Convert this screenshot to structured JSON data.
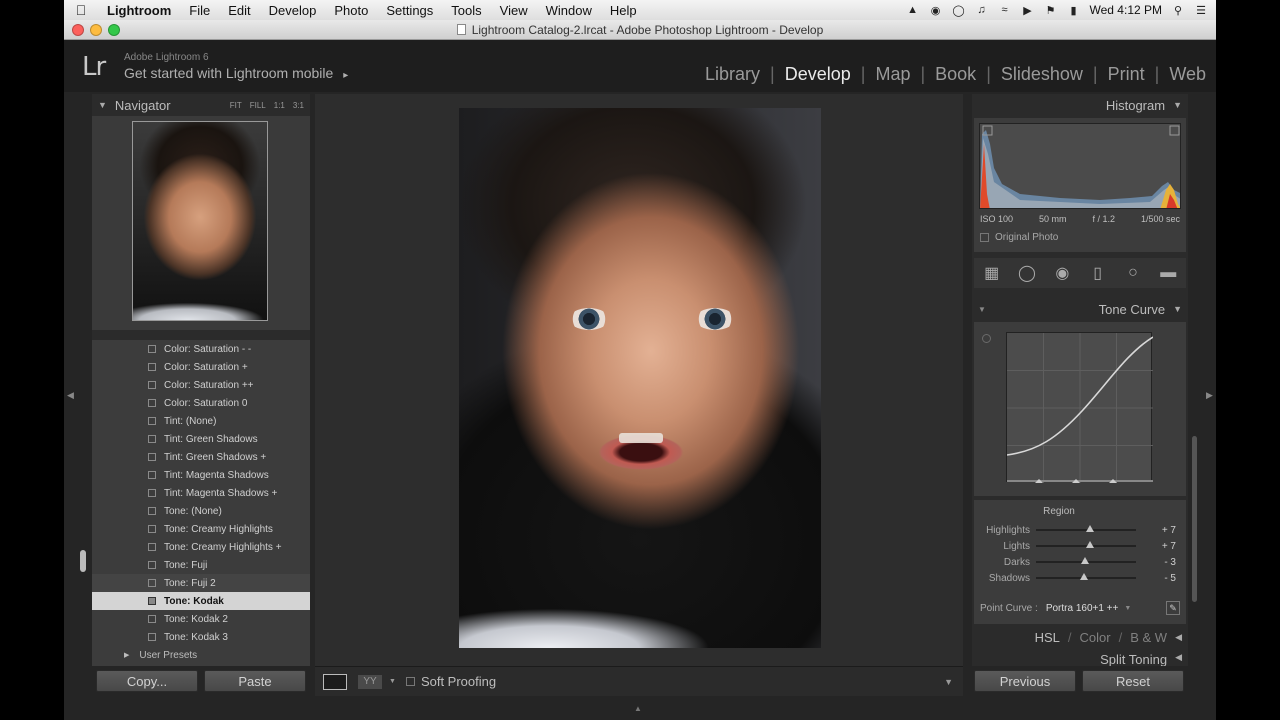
{
  "menubar": {
    "app": "Lightroom",
    "items": [
      "File",
      "Edit",
      "Develop",
      "Photo",
      "Settings",
      "Tools",
      "View",
      "Window",
      "Help"
    ],
    "clock": "Wed 4:12 PM"
  },
  "window": {
    "title": "Lightroom Catalog-2.lrcat - Adobe Photoshop Lightroom - Develop"
  },
  "identity": {
    "logo": "Lr",
    "version": "Adobe Lightroom 6",
    "mobile": "Get started with Lightroom mobile",
    "mobile_arrow": "▸"
  },
  "modules": [
    "Library",
    "Develop",
    "Map",
    "Book",
    "Slideshow",
    "Print",
    "Web"
  ],
  "active_module": "Develop",
  "navigator": {
    "title": "Navigator",
    "zoom_options": [
      "FIT",
      "FILL",
      "1:1",
      "3:1"
    ]
  },
  "presets": [
    {
      "label": "Color: Saturation - -"
    },
    {
      "label": "Color: Saturation +"
    },
    {
      "label": "Color: Saturation ++"
    },
    {
      "label": "Color: Saturation 0"
    },
    {
      "label": "Tint: (None)"
    },
    {
      "label": "Tint: Green Shadows"
    },
    {
      "label": "Tint: Green Shadows +"
    },
    {
      "label": "Tint: Magenta Shadows"
    },
    {
      "label": "Tint: Magenta Shadows +"
    },
    {
      "label": "Tone: (None)"
    },
    {
      "label": "Tone: Creamy Highlights"
    },
    {
      "label": "Tone: Creamy Highlights +"
    },
    {
      "label": "Tone: Fuji"
    },
    {
      "label": "Tone: Fuji 2",
      "state": "hover"
    },
    {
      "label": "Tone: Kodak",
      "state": "selected"
    },
    {
      "label": "Tone: Kodak 2"
    },
    {
      "label": "Tone: Kodak 3"
    }
  ],
  "user_presets": "User Presets",
  "left_buttons": {
    "copy": "Copy...",
    "paste": "Paste"
  },
  "toolbar": {
    "yy": "YY",
    "soft_proofing": "Soft Proofing"
  },
  "histogram": {
    "title": "Histogram",
    "iso": "ISO 100",
    "focal": "50 mm",
    "aperture": "f / 1.2",
    "shutter": "1/500 sec",
    "original_photo": "Original Photo"
  },
  "tone_curve": {
    "title": "Tone Curve",
    "region_title": "Region",
    "sliders": [
      {
        "label": "Highlights",
        "value": "+ 7",
        "level": 7
      },
      {
        "label": "Lights",
        "value": "+ 7",
        "level": 7
      },
      {
        "label": "Darks",
        "value": "- 3",
        "level": -3
      },
      {
        "label": "Shadows",
        "value": "- 5",
        "level": -5
      }
    ],
    "point_curve_label": "Point Curve :",
    "point_curve_value": "Portra 160+1 ++"
  },
  "hsl": {
    "hsl": "HSL",
    "color": "Color",
    "bw": "B & W"
  },
  "split_toning": "Split Toning",
  "right_buttons": {
    "previous": "Previous",
    "reset": "Reset"
  },
  "colors": {
    "panel_bg": "#2b2b2b",
    "list_bg": "#3c3c3c",
    "selected": "#d4d4d4",
    "active_module": "#eaeaea"
  }
}
